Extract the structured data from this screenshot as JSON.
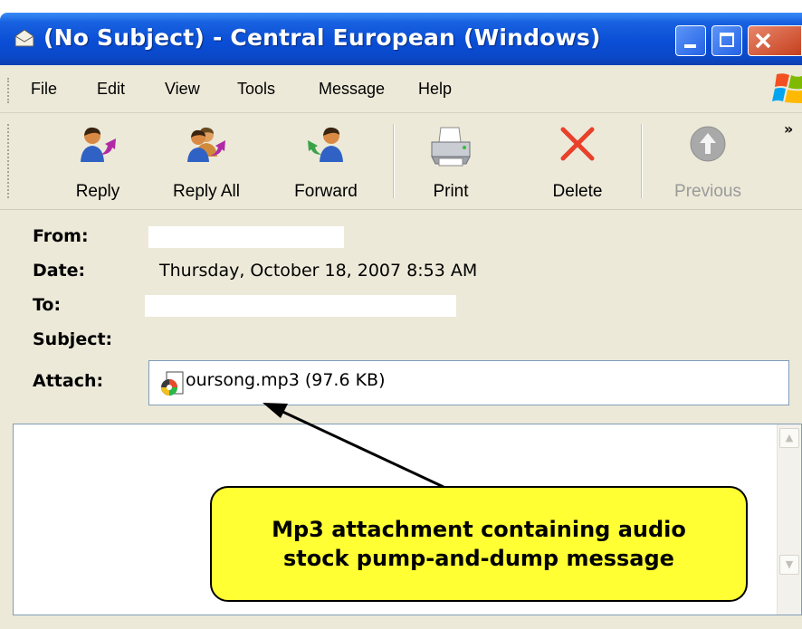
{
  "window": {
    "title": "(No Subject) - Central European (Windows)"
  },
  "menu": {
    "items": [
      "File",
      "Edit",
      "View",
      "Tools",
      "Message",
      "Help"
    ]
  },
  "toolbar": {
    "reply": "Reply",
    "reply_all": "Reply All",
    "forward": "Forward",
    "print": "Print",
    "delete": "Delete",
    "previous": "Previous",
    "overflow": "»"
  },
  "header": {
    "from_label": "From:",
    "date_label": "Date:",
    "date_value": "Thursday, October 18, 2007 8:53 AM",
    "to_label": "To:",
    "subject_label": "Subject:",
    "attach_label": "Attach:",
    "attachment": "oursong.mp3 (97.6 KB)"
  },
  "annotation": {
    "line1": "Mp3 attachment containing audio",
    "line2": "stock pump-and-dump message"
  },
  "colors": {
    "titlebar": "#0a4ed6",
    "chrome": "#ece9d8",
    "callout": "#ffff33",
    "delete_x": "#e8402a"
  }
}
